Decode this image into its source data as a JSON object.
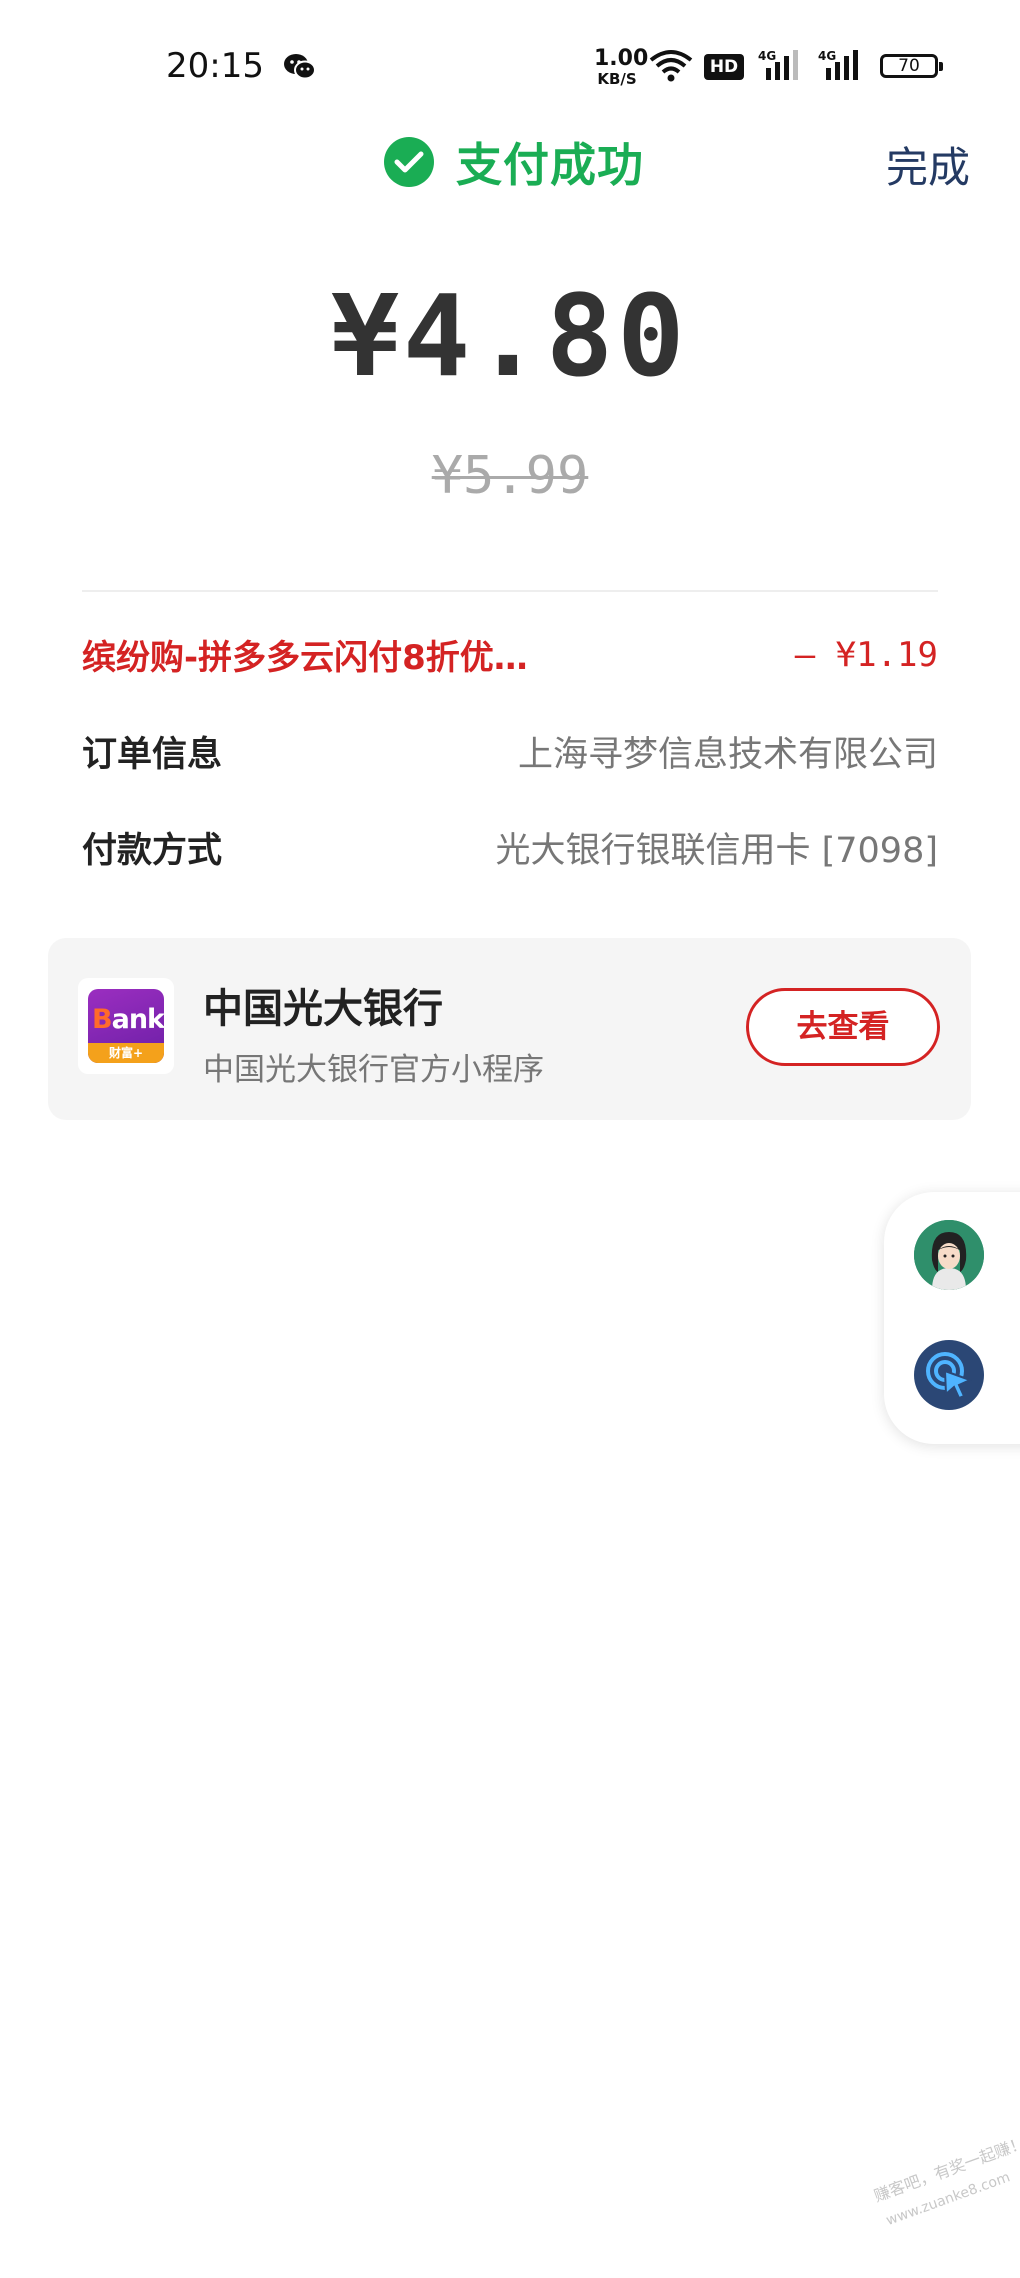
{
  "status_bar": {
    "time": "20:15",
    "net_speed_value": "1.00",
    "net_speed_unit": "KB/S",
    "hd_label": "HD",
    "signal1_label": "4G",
    "signal2_label": "4G",
    "battery": "70"
  },
  "header": {
    "status_text": "支付成功",
    "done_label": "完成",
    "accent_color": "#1aad54"
  },
  "payment": {
    "amount": "¥4.80",
    "original_amount": "¥5.99"
  },
  "details": {
    "promo_label": "缤纷购-拼多多云闪付8折优…",
    "promo_value": "– ¥1.19",
    "order_label": "订单信息",
    "order_value": "上海寻梦信息技术有限公司",
    "method_label": "付款方式",
    "method_value": "光大银行银联信用卡 [7098]"
  },
  "bank_card": {
    "logo_text_b": "B",
    "logo_text_rest": "ank",
    "logo_strip": "财富+",
    "title": "中国光大银行",
    "subtitle": "中国光大银行官方小程序",
    "button_label": "去查看"
  },
  "watermark": {
    "line1": "赚客吧，有奖一起赚！",
    "line2": "www.zuanke8.com"
  }
}
